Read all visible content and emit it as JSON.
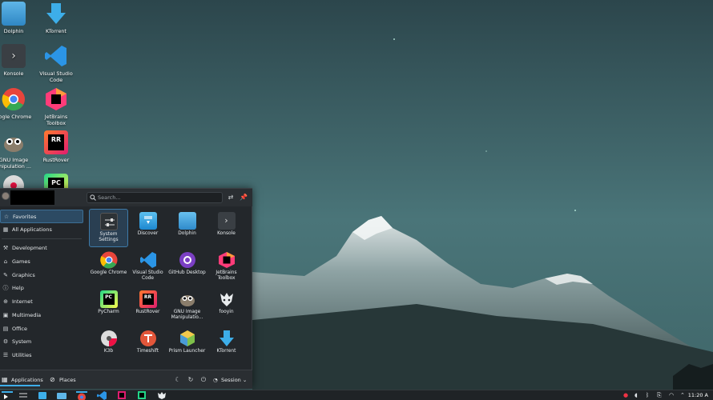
{
  "desktop": {
    "icons": [
      {
        "label": "Dolphin",
        "icon": "folder-icon"
      },
      {
        "label": "KTorrent",
        "icon": "ktorrent-icon"
      },
      {
        "label": "Konsole",
        "icon": "terminal-icon"
      },
      {
        "label": "Visual Studio Code",
        "icon": "vscode-icon"
      },
      {
        "label": "oogle Chrome",
        "icon": "chrome-icon"
      },
      {
        "label": "JetBrains Toolbox",
        "icon": "jetbrains-toolbox-icon"
      },
      {
        "label": "GNU Image anipulation ...",
        "icon": "gimp-icon"
      },
      {
        "label": "RustRover",
        "icon": "rustrover-icon"
      },
      {
        "label": "",
        "icon": "k3b-icon"
      },
      {
        "label": "",
        "icon": "pycharm-icon"
      }
    ]
  },
  "launcher": {
    "search_placeholder": "Search...",
    "categories": [
      {
        "label": "Favorites",
        "icon": "star-icon",
        "active": true
      },
      {
        "label": "All Applications",
        "icon": "grid-icon",
        "active": false
      },
      {
        "label": "Development",
        "icon": "wrench-icon",
        "active": false
      },
      {
        "label": "Games",
        "icon": "gamepad-icon",
        "active": false
      },
      {
        "label": "Graphics",
        "icon": "brush-icon",
        "active": false
      },
      {
        "label": "Help",
        "icon": "help-icon",
        "active": false
      },
      {
        "label": "Internet",
        "icon": "globe-icon",
        "active": false
      },
      {
        "label": "Multimedia",
        "icon": "multimedia-icon",
        "active": false
      },
      {
        "label": "Office",
        "icon": "document-icon",
        "active": false
      },
      {
        "label": "System",
        "icon": "gear-icon",
        "active": false
      },
      {
        "label": "Utilities",
        "icon": "utilities-icon",
        "active": false
      }
    ],
    "apps": [
      {
        "label": "System Settings",
        "icon": "system-settings-icon",
        "selected": true
      },
      {
        "label": "Discover",
        "icon": "discover-icon",
        "selected": false
      },
      {
        "label": "Dolphin",
        "icon": "folder-icon",
        "selected": false
      },
      {
        "label": "Konsole",
        "icon": "terminal-icon",
        "selected": false
      },
      {
        "label": "Google Chrome",
        "icon": "chrome-icon",
        "selected": false
      },
      {
        "label": "Visual Studio Code",
        "icon": "vscode-icon",
        "selected": false
      },
      {
        "label": "GitHub Desktop",
        "icon": "github-icon",
        "selected": false
      },
      {
        "label": "JetBrains Toolbox",
        "icon": "jetbrains-toolbox-icon",
        "selected": false
      },
      {
        "label": "PyCharm",
        "icon": "pycharm-icon",
        "selected": false
      },
      {
        "label": "RustRover",
        "icon": "rustrover-icon",
        "selected": false
      },
      {
        "label": "GNU Image Manipulatio...",
        "icon": "gimp-icon",
        "selected": false
      },
      {
        "label": "fooyin",
        "icon": "fooyin-icon",
        "selected": false
      },
      {
        "label": "K3b",
        "icon": "k3b-icon",
        "selected": false
      },
      {
        "label": "Timeshift",
        "icon": "timeshift-icon",
        "selected": false
      },
      {
        "label": "Prism Launcher",
        "icon": "prism-launcher-icon",
        "selected": false
      },
      {
        "label": "KTorrent",
        "icon": "ktorrent-icon",
        "selected": false
      }
    ],
    "footer": {
      "applications_label": "Applications",
      "places_label": "Places",
      "session_label": "Session"
    }
  },
  "taskbar": {
    "clock": "11:20 A"
  },
  "colors": {
    "accent": "#3daee9",
    "panel_bg": "#23272b"
  }
}
